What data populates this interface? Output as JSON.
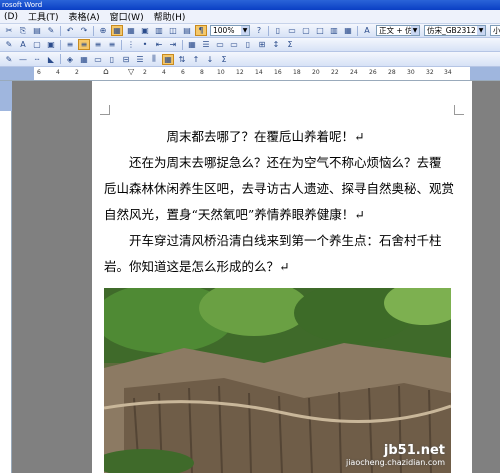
{
  "window": {
    "title": "rosoft Word"
  },
  "menu": [
    "(D)",
    "工具(T)",
    "表格(A)",
    "窗口(W)",
    "帮助(H)"
  ],
  "toolbar": {
    "zoom": "100%",
    "style": "正文 + 仿宋",
    "font": "仿宋_GB2312",
    "size": "小三"
  },
  "ruler": {
    "ticks": [
      "6",
      "4",
      "2",
      "2",
      "4",
      "6",
      "8",
      "10",
      "12",
      "14",
      "16",
      "18",
      "20",
      "22",
      "24",
      "26",
      "28",
      "30",
      "32",
      "34",
      "36",
      "38",
      "40"
    ]
  },
  "document": {
    "lines": [
      "　　　　　周末都去哪了？在覆卮山养着呢！↵",
      "　　还在为周末去哪捉急么？还在为空气不称心烦恼么？去覆",
      "卮山森林休闲养生区吧，去寻访古人遗迹、探寻自然奥秘、观赏",
      "自然风光，置身“天然氧吧”养情养眼养健康！↵",
      "　　开车穿过清风桥沿清白线来到第一个养生点：石舍村千柱",
      "岩。你知道这是怎么形成的么？↵"
    ]
  },
  "watermark": {
    "line1": "jb51.net",
    "line2": "jiaocheng.chazidian.com"
  },
  "colors": {
    "workspace": "#808080",
    "toolbar_active": "#f5c86a",
    "titlebar": "#0a3fc4"
  }
}
